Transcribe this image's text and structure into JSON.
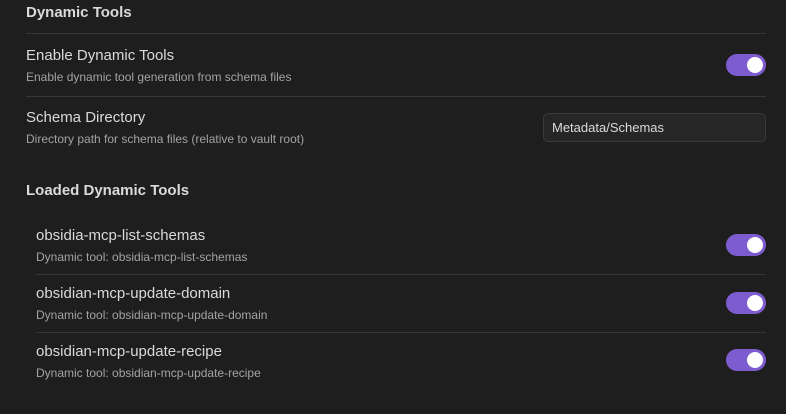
{
  "sections": {
    "dynamic_tools_heading": "Dynamic Tools",
    "loaded_heading": "Loaded Dynamic Tools"
  },
  "settings": {
    "enable": {
      "name": "Enable Dynamic Tools",
      "description": "Enable dynamic tool generation from schema files",
      "enabled": true
    },
    "schema_dir": {
      "name": "Schema Directory",
      "description": "Directory path for schema files (relative to vault root)",
      "value": "Metadata/Schemas"
    }
  },
  "loaded_tools": [
    {
      "name": "obsidia-mcp-list-schemas",
      "description": "Dynamic tool: obsidia-mcp-list-schemas",
      "enabled": true
    },
    {
      "name": "obsidian-mcp-update-domain",
      "description": "Dynamic tool: obsidian-mcp-update-domain",
      "enabled": true
    },
    {
      "name": "obsidian-mcp-update-recipe",
      "description": "Dynamic tool: obsidian-mcp-update-recipe",
      "enabled": true
    }
  ],
  "colors": {
    "background": "#1e1e1e",
    "accent": "#7c5ccf",
    "text": "#dadada",
    "muted": "#a3a3a3",
    "divider": "#363636"
  }
}
